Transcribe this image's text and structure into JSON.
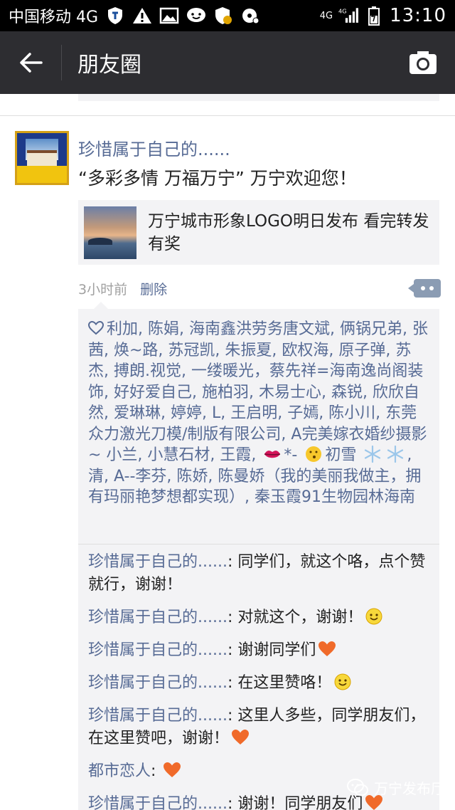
{
  "status_bar": {
    "carrier": "中国移动 4G",
    "network_small_top": "4G",
    "network_small_bottom": "4G",
    "time": "13:10"
  },
  "title_bar": {
    "title": "朋友圈",
    "back_icon": "arrow-left-icon",
    "camera_icon": "camera-icon"
  },
  "post": {
    "author": "珍惜属于自己的......",
    "text": "“多彩多情 万福万宁” 万宁欢迎您！",
    "link": {
      "title": "万宁城市形象LOGO明日发布 看完转发有奖"
    },
    "time": "3小时前",
    "delete_label": "删除"
  },
  "likes": {
    "part1": "利加, 陈娟, 海南鑫洪劳务唐文斌, 俩锅兄弟, 张茜, 焕~路, 苏冠凯, 朱振夏, 欧权海, 原子弹, 苏杰, 搏朗.视觉, 一缕暖光，蔡先祥=海南逸尚阁装饰, 好好爱自己, 施柏羽, 木易士心, 森锐, 欣欣自然, 爱琳琳, 婷婷, L, 王启明, 子嫣, 陈小川, 东莞众力激光刀模/制版有限公司, A完美嫁衣婚纱摄影 ~ 小兰, 小慧石材, 王霞, ",
    "part2": "*- ",
    "part3": "初雪 ",
    "part4": ", 清, A--李芬, 陈娇, 陈曼娇（我的美丽我做主，拥有玛丽艳梦想都实现）, 秦玉霞91生物园林海南"
  },
  "comments": [
    {
      "name": "珍惜属于自己的......",
      "text": ": 同学们，就这个咯，点个赞就行，谢谢！",
      "emoji": ""
    },
    {
      "name": "珍惜属于自己的......",
      "text": ": 对就这个，谢谢！",
      "emoji": "smile"
    },
    {
      "name": "珍惜属于自己的......",
      "text": ": 谢谢同学们",
      "emoji": "heart"
    },
    {
      "name": "珍惜属于自己的......",
      "text": ": 在这里赞咯！",
      "emoji": "smile"
    },
    {
      "name": "珍惜属于自己的......",
      "text": ": 这里人多些，同学朋友们，在这里赞吧，谢谢！",
      "emoji": "heart"
    },
    {
      "name": "都市恋人",
      "text": ": ",
      "emoji": "heart"
    },
    {
      "name": "珍惜属于自己的......",
      "text": ": 谢谢！同学朋友们",
      "emoji": "heart"
    }
  ],
  "watermark": {
    "label": "万宁发布厅"
  },
  "colors": {
    "link_blue": "#576b95",
    "title_bar": "#2d2d31",
    "panel_bg": "#f3f3f5"
  }
}
